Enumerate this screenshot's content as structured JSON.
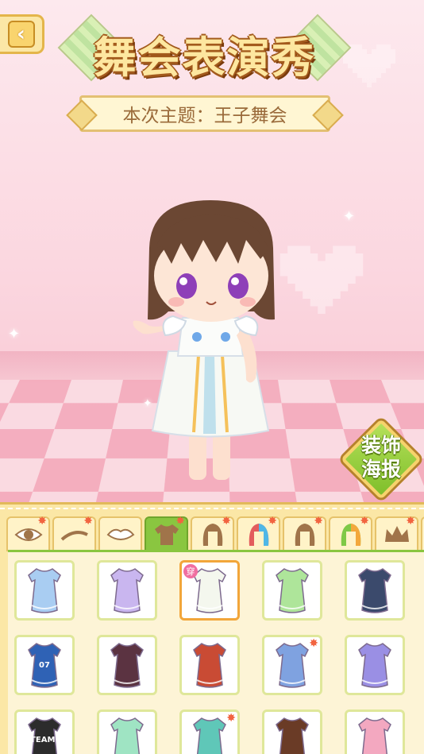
{
  "header": {
    "back_icon": "back-arrow-icon",
    "title": "舞会表演秀",
    "theme": "本次主题：王子舞会"
  },
  "poster_button": {
    "line1": "装饰",
    "line2": "海报"
  },
  "tabs": [
    {
      "icon": "eye-icon",
      "new": true,
      "active": false
    },
    {
      "icon": "eyebrow-icon",
      "new": true,
      "active": false
    },
    {
      "icon": "lips-icon",
      "new": false,
      "active": false
    },
    {
      "icon": "shirt-icon",
      "new": true,
      "active": true
    },
    {
      "icon": "hair-icon",
      "new": true,
      "active": false
    },
    {
      "icon": "hair-color-icon",
      "new": true,
      "active": false
    },
    {
      "icon": "long-hair-icon",
      "new": true,
      "active": false
    },
    {
      "icon": "hair-dye-icon",
      "new": true,
      "active": false
    },
    {
      "icon": "crown-icon",
      "new": true,
      "active": false
    },
    {
      "icon": "more-icon",
      "new": true,
      "active": false
    }
  ],
  "outfits": [
    {
      "name": "blue-sailor-dress",
      "color": "#a9cdf2",
      "star": false,
      "selected": false
    },
    {
      "name": "lavender-tutu-dress",
      "color": "#c9b6ef",
      "star": false,
      "selected": false
    },
    {
      "name": "white-fairy-dress",
      "color": "#f4f7ee",
      "star": false,
      "selected": true,
      "badge": "穿"
    },
    {
      "name": "green-frog-dress",
      "color": "#aee59a",
      "star": false,
      "selected": false
    },
    {
      "name": "navy-suspender-outfit",
      "color": "#3b4a6c",
      "star": false,
      "selected": false
    },
    {
      "name": "jersey-07-dress",
      "color": "#2f62b5",
      "star": false,
      "selected": false,
      "text": "07"
    },
    {
      "name": "maid-outfit",
      "color": "#5b3341",
      "star": false,
      "selected": false
    },
    {
      "name": "red-cape-gown",
      "color": "#c94b34",
      "star": false,
      "selected": false
    },
    {
      "name": "blue-kimono",
      "color": "#7fa2e0",
      "star": true,
      "selected": false
    },
    {
      "name": "purple-polka-dress",
      "color": "#9a8fe4",
      "star": false,
      "selected": false
    },
    {
      "name": "black-team-shirt",
      "color": "#2c2c2c",
      "star": false,
      "selected": false,
      "text": "TEAM!"
    },
    {
      "name": "mint-bear-dress",
      "color": "#9fe4c3",
      "star": false,
      "selected": false
    },
    {
      "name": "teal-qipao",
      "color": "#5fc7b8",
      "star": true,
      "selected": false
    },
    {
      "name": "brown-armor",
      "color": "#6a3b26",
      "star": false,
      "selected": false
    },
    {
      "name": "pink-flower-dress",
      "color": "#f3a8c0",
      "star": false,
      "selected": false
    }
  ]
}
